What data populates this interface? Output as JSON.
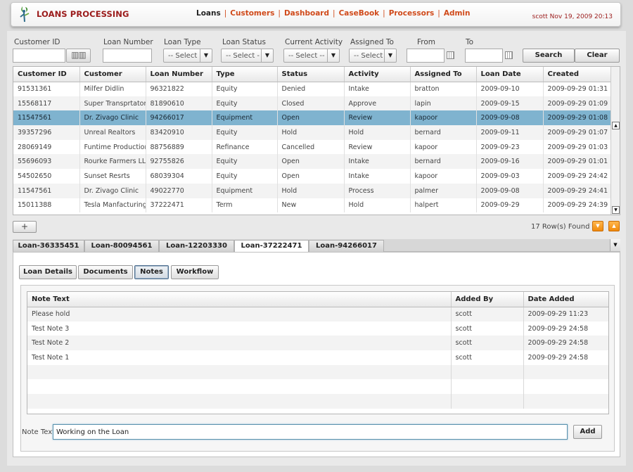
{
  "header": {
    "title": "LOANS PROCESSING",
    "nav": [
      {
        "label": "Loans",
        "active": true
      },
      {
        "label": "Customers",
        "active": false
      },
      {
        "label": "Dashboard",
        "active": false
      },
      {
        "label": "CaseBook",
        "active": false
      },
      {
        "label": "Processors",
        "active": false
      },
      {
        "label": "Admin",
        "active": false
      }
    ],
    "user_info": "scott Nov 19, 2009 20:13"
  },
  "filters": {
    "customer_id_label": "Customer ID",
    "loan_number_label": "Loan Number",
    "loan_type_label": "Loan Type",
    "loan_type_value": "-- Select",
    "loan_status_label": "Loan Status",
    "loan_status_value": "-- Select -",
    "current_activity_label": "Current Activity",
    "current_activity_value": "-- Select --",
    "assigned_to_label": "Assigned To",
    "assigned_to_value": "-- Select",
    "from_label": "From",
    "to_label": "To",
    "search_label": "Search",
    "clear_label": "Clear"
  },
  "loans_table": {
    "columns": [
      "Customer ID",
      "Customer",
      "Loan Number",
      "Type",
      "Status",
      "Activity",
      "Assigned To",
      "Loan Date",
      "Created"
    ],
    "rows": [
      [
        "91531361",
        "Milfer Didlin",
        "96321822",
        "Equity",
        "Denied",
        "Intake",
        "bratton",
        "2009-09-10",
        "2009-09-29 01:31"
      ],
      [
        "15568117",
        "Super Transprtator",
        "81890610",
        "Equity",
        "Closed",
        "Approve",
        "lapin",
        "2009-09-15",
        "2009-09-29 01:09"
      ],
      [
        "11547561",
        "Dr. Zivago Clinic",
        "94266017",
        "Equipment",
        "Open",
        "Review",
        "kapoor",
        "2009-09-08",
        "2009-09-29 01:08"
      ],
      [
        "39357296",
        "Unreal Realtors",
        "83420910",
        "Equity",
        "Hold",
        "Hold",
        "bernard",
        "2009-09-11",
        "2009-09-29 01:07"
      ],
      [
        "28069149",
        "Funtime Productions",
        "88756889",
        "Refinance",
        "Cancelled",
        "Review",
        "kapoor",
        "2009-09-23",
        "2009-09-29 01:03"
      ],
      [
        "55696093",
        "Rourke Farmers LLC",
        "92755826",
        "Equity",
        "Open",
        "Intake",
        "bernard",
        "2009-09-16",
        "2009-09-29 01:01"
      ],
      [
        "54502650",
        "Sunset Resrts",
        "68039304",
        "Equity",
        "Open",
        "Intake",
        "kapoor",
        "2009-09-03",
        "2009-09-29 24:42"
      ],
      [
        "11547561",
        "Dr. Zivago Clinic",
        "49022770",
        "Equipment",
        "Hold",
        "Process",
        "palmer",
        "2009-09-08",
        "2009-09-29 24:41"
      ],
      [
        "15011388",
        "Tesla Manfacturing",
        "37222471",
        "Term",
        "New",
        "Hold",
        "halpert",
        "2009-09-29",
        "2009-09-29 24:39"
      ]
    ],
    "selected_row": 2,
    "add_row_label": "+",
    "rows_found": "17 Row(s) Found"
  },
  "loan_tabs": [
    "Loan-36335451",
    "Loan-80094561",
    "Loan-12203330",
    "Loan-37222471",
    "Loan-94266017"
  ],
  "active_loan_tab": 3,
  "sub_tabs": [
    "Loan Details",
    "Documents",
    "Notes",
    "Workflow"
  ],
  "active_sub_tab": 2,
  "notes": {
    "columns": [
      "Note Text",
      "Added By",
      "Date Added"
    ],
    "rows": [
      [
        "Please hold",
        "scott",
        "2009-09-29 11:23"
      ],
      [
        "Test Note 3",
        "scott",
        "2009-09-29 24:58"
      ],
      [
        "Test Note 2",
        "scott",
        "2009-09-29 24:58"
      ],
      [
        "Test Note 1",
        "scott",
        "2009-09-29 24:58"
      ]
    ],
    "note_text_label": "Note Text",
    "note_text_value": "Working on the Loan",
    "add_label": "Add"
  },
  "colors": {
    "brand": "#9b1b1b",
    "nav_link": "#d04a1a",
    "selection": "#7fb3cf",
    "accent": "#f08a0c"
  }
}
